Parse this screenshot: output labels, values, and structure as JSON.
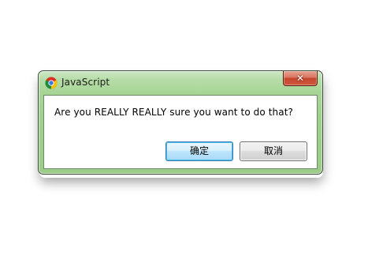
{
  "dialog": {
    "title": "JavaScript",
    "app_icon": "chrome-icon",
    "close_glyph": "✕",
    "message": "Are you REALLY REALLY sure you want to do that?",
    "ok_label": "确定",
    "cancel_label": "取消"
  },
  "colors": {
    "frame_green": "#a7d596",
    "close_red": "#c5452c",
    "default_button_border": "#3c7fb1"
  }
}
